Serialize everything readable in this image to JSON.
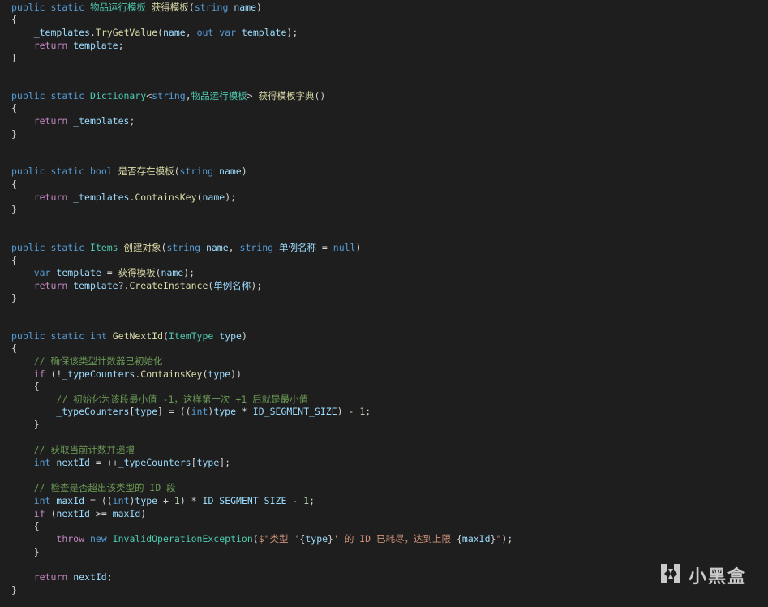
{
  "colors": {
    "background": "#1e1e1e",
    "keyword": "#569cd6",
    "control": "#c586c0",
    "type": "#4ec9b0",
    "function": "#dcdcaa",
    "variable": "#9cdcfe",
    "string": "#ce9178",
    "comment": "#6a9955",
    "number": "#b5cea8",
    "plain": "#d4d4d4"
  },
  "code_lines": [
    [
      [
        "kw",
        "public"
      ],
      [
        "pl",
        " "
      ],
      [
        "kw",
        "static"
      ],
      [
        "pl",
        " "
      ],
      [
        "ty",
        "物品运行模板"
      ],
      [
        "pl",
        " "
      ],
      [
        "fn",
        "获得模板"
      ],
      [
        "pl",
        "("
      ],
      [
        "kw",
        "string"
      ],
      [
        "pl",
        " "
      ],
      [
        "var",
        "name"
      ],
      [
        "pl",
        ")"
      ]
    ],
    [
      [
        "pl",
        "{"
      ]
    ],
    [
      [
        "pl",
        "    "
      ],
      [
        "var",
        "_templates"
      ],
      [
        "pl",
        "."
      ],
      [
        "fn",
        "TryGetValue"
      ],
      [
        "pl",
        "("
      ],
      [
        "var",
        "name"
      ],
      [
        "pl",
        ", "
      ],
      [
        "kw",
        "out"
      ],
      [
        "pl",
        " "
      ],
      [
        "kw",
        "var"
      ],
      [
        "pl",
        " "
      ],
      [
        "var",
        "template"
      ],
      [
        "pl",
        ");"
      ]
    ],
    [
      [
        "pl",
        "    "
      ],
      [
        "ctl",
        "return"
      ],
      [
        "pl",
        " "
      ],
      [
        "var",
        "template"
      ],
      [
        "pl",
        ";"
      ]
    ],
    [
      [
        "pl",
        "}"
      ]
    ],
    [
      [
        "kw",
        "public"
      ],
      [
        "pl",
        " "
      ],
      [
        "kw",
        "static"
      ],
      [
        "pl",
        " "
      ],
      [
        "ty",
        "Dictionary"
      ],
      [
        "pl",
        "<"
      ],
      [
        "kw",
        "string"
      ],
      [
        "pl",
        ","
      ],
      [
        "ty",
        "物品运行模板"
      ],
      [
        "pl",
        "> "
      ],
      [
        "fn",
        "获得模板字典"
      ],
      [
        "pl",
        "()"
      ]
    ],
    [
      [
        "pl",
        "{"
      ]
    ],
    [
      [
        "pl",
        "    "
      ],
      [
        "ctl",
        "return"
      ],
      [
        "pl",
        " "
      ],
      [
        "var",
        "_templates"
      ],
      [
        "pl",
        ";"
      ]
    ],
    [
      [
        "pl",
        "}"
      ]
    ],
    [
      [
        "kw",
        "public"
      ],
      [
        "pl",
        " "
      ],
      [
        "kw",
        "static"
      ],
      [
        "pl",
        " "
      ],
      [
        "kw",
        "bool"
      ],
      [
        "pl",
        " "
      ],
      [
        "fn",
        "是否存在模板"
      ],
      [
        "pl",
        "("
      ],
      [
        "kw",
        "string"
      ],
      [
        "pl",
        " "
      ],
      [
        "var",
        "name"
      ],
      [
        "pl",
        ")"
      ]
    ],
    [
      [
        "pl",
        "{"
      ]
    ],
    [
      [
        "pl",
        "    "
      ],
      [
        "ctl",
        "return"
      ],
      [
        "pl",
        " "
      ],
      [
        "var",
        "_templates"
      ],
      [
        "pl",
        "."
      ],
      [
        "fn",
        "ContainsKey"
      ],
      [
        "pl",
        "("
      ],
      [
        "var",
        "name"
      ],
      [
        "pl",
        ");"
      ]
    ],
    [
      [
        "pl",
        "}"
      ]
    ],
    [
      [
        "kw",
        "public"
      ],
      [
        "pl",
        " "
      ],
      [
        "kw",
        "static"
      ],
      [
        "pl",
        " "
      ],
      [
        "ty",
        "Items"
      ],
      [
        "pl",
        " "
      ],
      [
        "fn",
        "创建对象"
      ],
      [
        "pl",
        "("
      ],
      [
        "kw",
        "string"
      ],
      [
        "pl",
        " "
      ],
      [
        "var",
        "name"
      ],
      [
        "pl",
        ", "
      ],
      [
        "kw",
        "string"
      ],
      [
        "pl",
        " "
      ],
      [
        "var",
        "单例名称"
      ],
      [
        "pl",
        " = "
      ],
      [
        "kw",
        "null"
      ],
      [
        "pl",
        ")"
      ]
    ],
    [
      [
        "pl",
        "{"
      ]
    ],
    [
      [
        "pl",
        "    "
      ],
      [
        "kw",
        "var"
      ],
      [
        "pl",
        " "
      ],
      [
        "var",
        "template"
      ],
      [
        "pl",
        " = "
      ],
      [
        "fn",
        "获得模板"
      ],
      [
        "pl",
        "("
      ],
      [
        "var",
        "name"
      ],
      [
        "pl",
        ");"
      ]
    ],
    [
      [
        "pl",
        "    "
      ],
      [
        "ctl",
        "return"
      ],
      [
        "pl",
        " "
      ],
      [
        "var",
        "template"
      ],
      [
        "pl",
        "?."
      ],
      [
        "fn",
        "CreateInstance"
      ],
      [
        "pl",
        "("
      ],
      [
        "var",
        "单例名称"
      ],
      [
        "pl",
        ");"
      ]
    ],
    [
      [
        "pl",
        "}"
      ]
    ],
    [
      [
        "kw",
        "public"
      ],
      [
        "pl",
        " "
      ],
      [
        "kw",
        "static"
      ],
      [
        "pl",
        " "
      ],
      [
        "kw",
        "int"
      ],
      [
        "pl",
        " "
      ],
      [
        "fn",
        "GetNextId"
      ],
      [
        "pl",
        "("
      ],
      [
        "ty",
        "ItemType"
      ],
      [
        "pl",
        " "
      ],
      [
        "var",
        "type"
      ],
      [
        "pl",
        ")"
      ]
    ],
    [
      [
        "pl",
        "{"
      ]
    ],
    [
      [
        "pl",
        "    "
      ],
      [
        "cm",
        "// 确保该类型计数器已初始化"
      ]
    ],
    [
      [
        "pl",
        "    "
      ],
      [
        "ctl",
        "if"
      ],
      [
        "pl",
        " (!"
      ],
      [
        "var",
        "_typeCounters"
      ],
      [
        "pl",
        "."
      ],
      [
        "fn",
        "ContainsKey"
      ],
      [
        "pl",
        "("
      ],
      [
        "var",
        "type"
      ],
      [
        "pl",
        "))"
      ]
    ],
    [
      [
        "pl",
        "    {"
      ]
    ],
    [
      [
        "pl",
        "        "
      ],
      [
        "cm",
        "// 初始化为该段最小值 -1，这样第一次 +1 后就是最小值"
      ]
    ],
    [
      [
        "pl",
        "        "
      ],
      [
        "var",
        "_typeCounters"
      ],
      [
        "pl",
        "["
      ],
      [
        "var",
        "type"
      ],
      [
        "pl",
        "] = (("
      ],
      [
        "kw",
        "int"
      ],
      [
        "pl",
        ")"
      ],
      [
        "var",
        "type"
      ],
      [
        "pl",
        " * "
      ],
      [
        "var",
        "ID_SEGMENT_SIZE"
      ],
      [
        "pl",
        ") - "
      ],
      [
        "num",
        "1"
      ],
      [
        "pl",
        ";"
      ]
    ],
    [
      [
        "pl",
        "    }"
      ]
    ],
    [
      [
        "pl",
        "    "
      ],
      [
        "cm",
        "// 获取当前计数并递增"
      ]
    ],
    [
      [
        "pl",
        "    "
      ],
      [
        "kw",
        "int"
      ],
      [
        "pl",
        " "
      ],
      [
        "var",
        "nextId"
      ],
      [
        "pl",
        " = ++"
      ],
      [
        "var",
        "_typeCounters"
      ],
      [
        "pl",
        "["
      ],
      [
        "var",
        "type"
      ],
      [
        "pl",
        "];"
      ]
    ],
    [
      [
        "pl",
        "    "
      ],
      [
        "cm",
        "// 检查是否超出该类型的 ID 段"
      ]
    ],
    [
      [
        "pl",
        "    "
      ],
      [
        "kw",
        "int"
      ],
      [
        "pl",
        " "
      ],
      [
        "var",
        "maxId"
      ],
      [
        "pl",
        " = (("
      ],
      [
        "kw",
        "int"
      ],
      [
        "pl",
        ")"
      ],
      [
        "var",
        "type"
      ],
      [
        "pl",
        " + "
      ],
      [
        "num",
        "1"
      ],
      [
        "pl",
        ") * "
      ],
      [
        "var",
        "ID_SEGMENT_SIZE"
      ],
      [
        "pl",
        " - "
      ],
      [
        "num",
        "1"
      ],
      [
        "pl",
        ";"
      ]
    ],
    [
      [
        "pl",
        "    "
      ],
      [
        "ctl",
        "if"
      ],
      [
        "pl",
        " ("
      ],
      [
        "var",
        "nextId"
      ],
      [
        "pl",
        " >= "
      ],
      [
        "var",
        "maxId"
      ],
      [
        "pl",
        ")"
      ]
    ],
    [
      [
        "pl",
        "    {"
      ]
    ],
    [
      [
        "pl",
        "        "
      ],
      [
        "ctl",
        "throw"
      ],
      [
        "pl",
        " "
      ],
      [
        "kw",
        "new"
      ],
      [
        "pl",
        " "
      ],
      [
        "ty",
        "InvalidOperationException"
      ],
      [
        "pl",
        "("
      ],
      [
        "str",
        "$\"类型 '"
      ],
      [
        "pl",
        "{"
      ],
      [
        "var",
        "type"
      ],
      [
        "pl",
        "}"
      ],
      [
        "str",
        "' 的 ID 已耗尽，达到上限 "
      ],
      [
        "pl",
        "{"
      ],
      [
        "var",
        "maxId"
      ],
      [
        "pl",
        "}"
      ],
      [
        "str",
        "\""
      ],
      [
        "pl",
        ");"
      ]
    ],
    [
      [
        "pl",
        "    }"
      ]
    ],
    [
      [
        "pl",
        "    "
      ],
      [
        "ctl",
        "return"
      ],
      [
        "pl",
        " "
      ],
      [
        "var",
        "nextId"
      ],
      [
        "pl",
        ";"
      ]
    ],
    [
      [
        "pl",
        "}"
      ]
    ]
  ],
  "watermark": {
    "text": "小黑盒",
    "icon": "heybox-logo-icon"
  }
}
